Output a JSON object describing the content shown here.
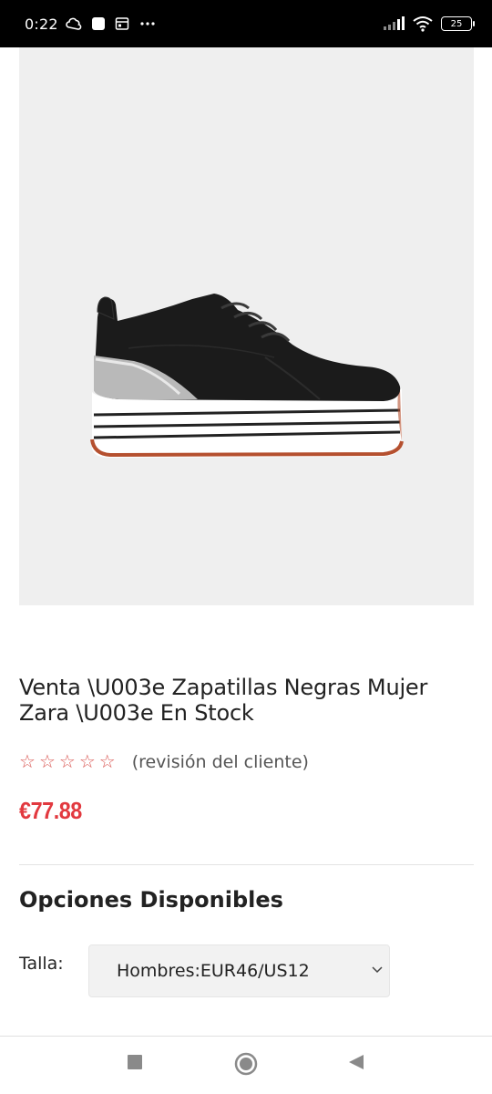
{
  "status_bar": {
    "time": "0:22",
    "battery": "25"
  },
  "product": {
    "title": "Venta \\U003e Zapatillas Negras Mujer Zara \\U003e En Stock",
    "stars": [
      "☆",
      "☆",
      "☆",
      "☆",
      "☆"
    ],
    "review_text": "(revisión del cliente)",
    "price": "€77.88",
    "colors": {
      "price": "#e2393f",
      "stars": "#d9534f",
      "image_background": "#efefef"
    }
  },
  "options": {
    "heading": "Opciones Disponibles",
    "size_label": "Talla:",
    "size_selected": "Hombres:EUR46/US12"
  },
  "nav": {
    "icons": [
      "recents-square-icon",
      "home-circle-icon",
      "back-triangle-icon"
    ]
  }
}
